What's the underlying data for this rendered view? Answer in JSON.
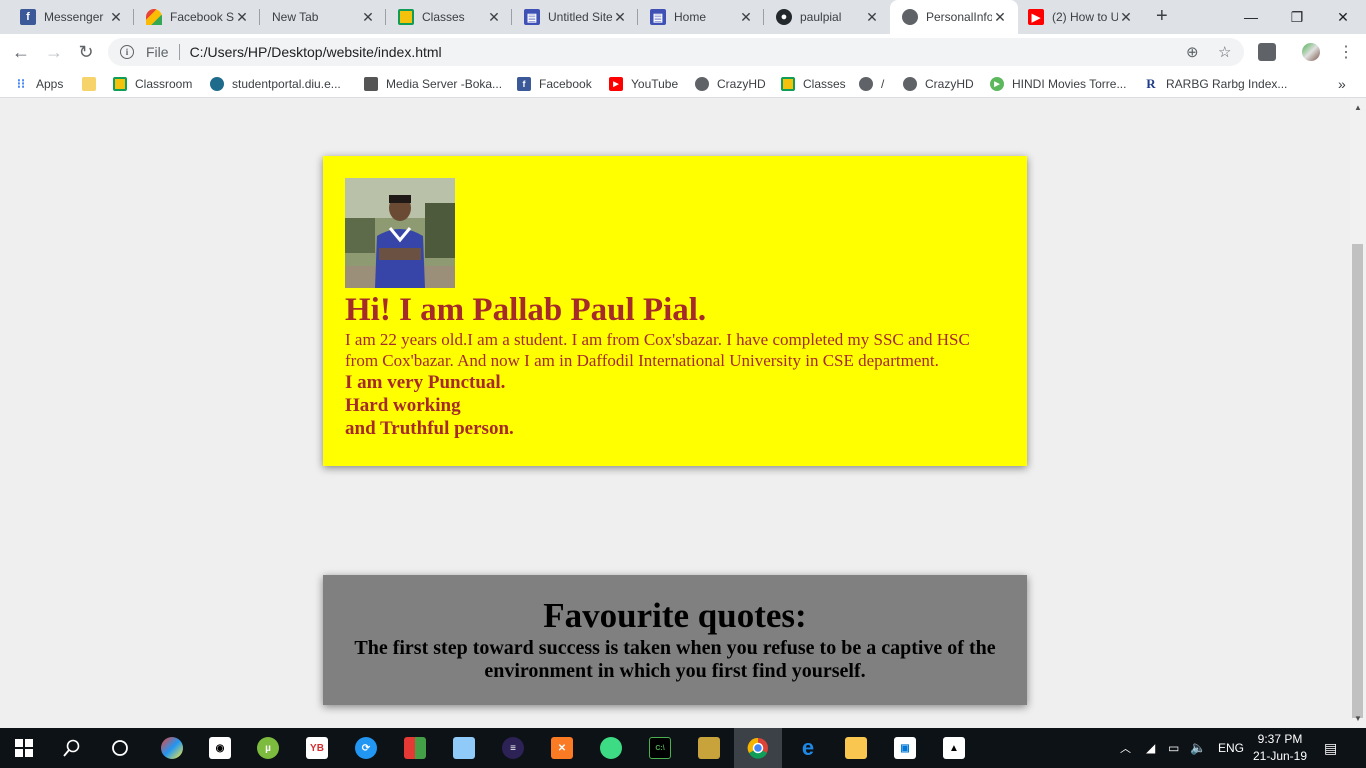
{
  "browser": {
    "tabs": [
      {
        "title": "Messenger",
        "icon": "facebook-icon",
        "color": "#3b5998",
        "active": false
      },
      {
        "title": "Facebook Si",
        "icon": "google-sites-icon",
        "color": "#f4b400",
        "active": false
      },
      {
        "title": "New Tab",
        "icon": "none",
        "color": "",
        "active": false
      },
      {
        "title": "Classes",
        "icon": "google-classroom-icon",
        "color": "#f4c20d",
        "active": false
      },
      {
        "title": "Untitled Site",
        "icon": "google-sites-icon",
        "color": "#3f51b5",
        "active": false
      },
      {
        "title": "Home",
        "icon": "google-sites-icon",
        "color": "#3f51b5",
        "active": false
      },
      {
        "title": "paulpial",
        "icon": "github-icon",
        "color": "#24292e",
        "active": false
      },
      {
        "title": "PersonalInfo",
        "icon": "globe-icon",
        "color": "#5f6368",
        "active": true
      },
      {
        "title": "(2) How to U",
        "icon": "youtube-icon",
        "color": "#ff0000",
        "active": false
      }
    ],
    "new_tab_label": "+",
    "close_glyph": "✕",
    "scheme_label": "File",
    "url": "C:/Users/HP/Desktop/website/index.html",
    "bookmarks": [
      {
        "label": "Apps",
        "icon": "apps-grid-icon",
        "color": "#4285f4"
      },
      {
        "label": "",
        "icon": "folder-icon",
        "color": "#f6d36b"
      },
      {
        "label": "Classroom",
        "icon": "google-classroom-icon",
        "color": "#f4c20d"
      },
      {
        "label": "studentportal.diu.e...",
        "icon": "diu-icon",
        "color": "#1e6b8c"
      },
      {
        "label": "Media Server -Boka...",
        "icon": "media-server-icon",
        "color": "#555555"
      },
      {
        "label": "Facebook",
        "icon": "facebook-icon",
        "color": "#3b5998"
      },
      {
        "label": "YouTube",
        "icon": "youtube-icon",
        "color": "#ff0000"
      },
      {
        "label": "CrazyHD",
        "icon": "globe-icon",
        "color": "#5f6368"
      },
      {
        "label": "Classes",
        "icon": "google-classroom-icon",
        "color": "#f4c20d"
      },
      {
        "label": "/",
        "icon": "globe-icon",
        "color": "#5f6368"
      },
      {
        "label": "CrazyHD",
        "icon": "globe-icon",
        "color": "#5f6368"
      },
      {
        "label": "HINDI Movies Torre...",
        "icon": "play-icon",
        "color": "#5cb85c"
      },
      {
        "label": "RARBG Rarbg Index...",
        "icon": "rarbg-icon",
        "color": "#1f3c88"
      }
    ],
    "more_bookmarks_glyph": "»"
  },
  "page": {
    "intro": {
      "heading": "Hi! I am Pallab Paul Pial.",
      "bio": "I am 22 years old.I am a student. I am from Cox'sbazar. I have completed my SSC and HSC from Cox'bazar. And now I am in Daffodil International University in CSE department.",
      "traits": [
        "I am very Punctual.",
        "Hard working",
        "and Truthful person."
      ],
      "photo_alt": "profile-photo"
    },
    "quote": {
      "heading": "Favourite quotes:",
      "text": "The first step toward success is taken when you refuse to be a captive of the environment in which you first find yourself."
    },
    "colors": {
      "intro_bg": "#ffff00",
      "intro_text": "#a52a2a",
      "quote_bg": "#808080",
      "page_bg": "#efefef"
    }
  },
  "taskbar": {
    "language": "ENG",
    "time": "9:37 PM",
    "date": "21-Jun-19"
  }
}
